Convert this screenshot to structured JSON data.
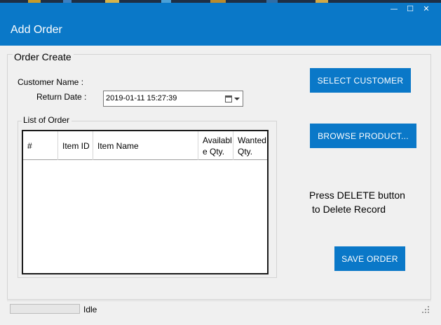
{
  "window": {
    "header_title": "Add Order",
    "minimize_glyph": "—",
    "maximize_glyph": "☐",
    "close_glyph": "✕"
  },
  "form": {
    "group_title": "Order Create",
    "customer_label": "Customer Name :",
    "return_date_label": "Return Date :",
    "return_date_value": "2019-01-11 15:27:39"
  },
  "order_list": {
    "group_title": "List of Order",
    "columns": [
      "#",
      "Item ID",
      "Item Name",
      "Available Qty.",
      "Wanted Qty."
    ],
    "rows": []
  },
  "buttons": {
    "select_customer": "SELECT CUSTOMER",
    "browse_product": "BROWSE PRODUCT...",
    "save_order": "SAVE ORDER"
  },
  "hint": {
    "line1": "Press DELETE button",
    "line2": "to Delete Record"
  },
  "status": {
    "text": "Idle",
    "progress": 0
  },
  "colors": {
    "accent": "#0a78c8",
    "window_bg": "#f0f0f0"
  }
}
